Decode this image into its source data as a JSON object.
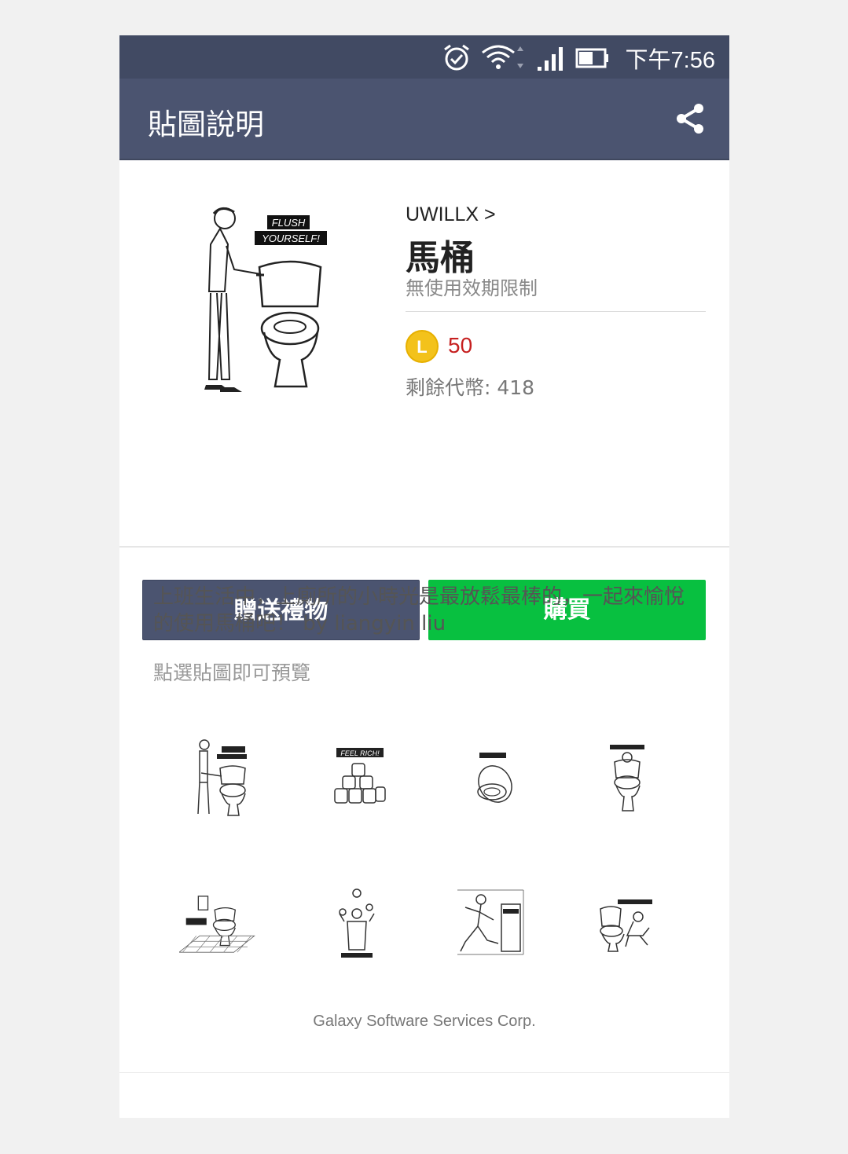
{
  "status_bar": {
    "time": "下午7:56",
    "icons": [
      "alarm-icon",
      "wifi-icon",
      "signal-icon",
      "battery-icon"
    ]
  },
  "header": {
    "title": "貼圖說明",
    "share_icon": "share-icon"
  },
  "pack": {
    "author": "UWILLX >",
    "title": "馬桶",
    "validity": "無使用效期限制",
    "coin_symbol": "L",
    "price": "50",
    "balance": "剩餘代幣: 418",
    "sticker_caption": [
      "FLUSH",
      "YOURSELF!"
    ]
  },
  "buttons": {
    "gift": "贈送禮物",
    "buy": "購買"
  },
  "description": "上班生活中，上廁所的小時光是最放鬆最棒的，一起來愉悅的使用馬桶吧！ by liangyin liu",
  "preview_hint": "點選貼圖即可預覽",
  "stickers": [
    {
      "name": "flush-yourself",
      "caption": "FLUSH YOURSELF"
    },
    {
      "name": "feel-rich",
      "caption": "FEEL RICH!"
    },
    {
      "name": "be-polite",
      "caption": "BE POLITE"
    },
    {
      "name": "im-working",
      "caption": "I'M WORKING"
    },
    {
      "name": "perfect-day",
      "caption": "PERFECT DAY"
    },
    {
      "name": "show-time",
      "caption": "SHOW TIME!"
    },
    {
      "name": "done",
      "caption": "DONE"
    },
    {
      "name": "just-cant",
      "caption": "JUST CAN'T"
    }
  ],
  "footer": "Galaxy Software Services Corp.",
  "colors": {
    "status_bar": "#414a63",
    "app_bar": "#4b5470",
    "buy": "#08c040",
    "price": "#c61f1f",
    "coin": "#f3c21b"
  }
}
